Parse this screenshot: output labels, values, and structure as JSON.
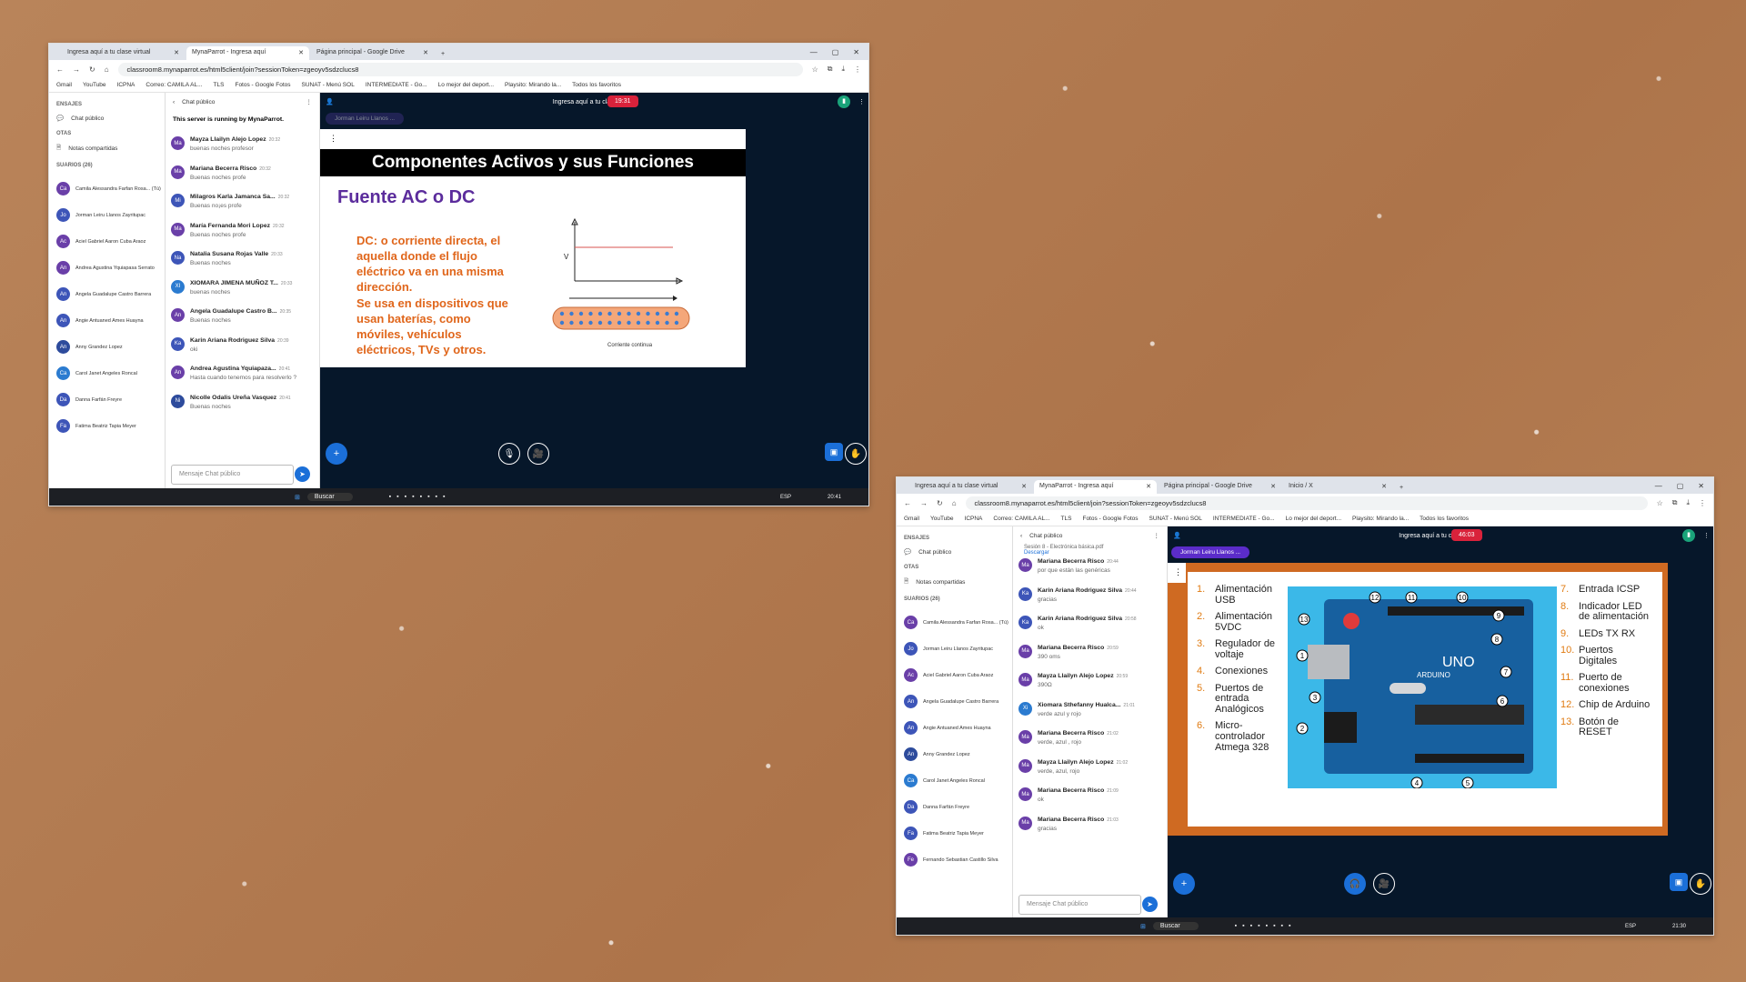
{
  "shot1": {
    "tabs": [
      {
        "label": "Ingresa aquí a tu clase virtual"
      },
      {
        "label": "MynaParrot - Ingresa aquí"
      },
      {
        "label": "Página principal - Google Drive"
      }
    ],
    "url": "classroom8.mynaparrot.es/html5client/join?sessionToken=zgeoyv5sdzclucs8",
    "bookmarks": [
      "Gmail",
      "YouTube",
      "ICPNA",
      "Correo: CAMILA AL...",
      "TLS",
      "Fotos - Google Fotos",
      "SUNAT - Menú SOL",
      "INTERMEDIATE - Go...",
      "Lo mejor del deport...",
      "Playsito: Mirando la...",
      "Todos los favoritos"
    ],
    "sidebar": {
      "mensajes": "ENSAJES",
      "public_chat": "Chat público",
      "notas": "OTAS",
      "shared_notes": "Notas compartidas",
      "usuarios": "SUARIOS (26)",
      "users": [
        {
          "ini": "Ca",
          "name": "Camila Alessandra Farfan Rosa... (Tú)",
          "color": "#6a3fa8"
        },
        {
          "ini": "Jo",
          "name": "Jorman Leiru Llanos Zayritupac",
          "color": "#3d55b8"
        },
        {
          "ini": "Ac",
          "name": "Aciel Gabriel Aaron Cuba Araoz",
          "color": "#6a3fa8"
        },
        {
          "ini": "An",
          "name": "Andrea Agustina Yquiapasa Serrato",
          "color": "#6a3fa8"
        },
        {
          "ini": "An",
          "name": "Angela Guadalupe Castro Barrera",
          "color": "#3d55b8"
        },
        {
          "ini": "An",
          "name": "Angie Antuaned Ames Huayna",
          "color": "#3d55b8"
        },
        {
          "ini": "An",
          "name": "Anny Grandez Lopez",
          "color": "#2d4b9c"
        },
        {
          "ini": "Ca",
          "name": "Carol Janet Angeles Roncal",
          "color": "#2b7bd0"
        },
        {
          "ini": "Da",
          "name": "Danna Farfán Freyre",
          "color": "#3d55b8"
        },
        {
          "ini": "Fa",
          "name": "Fatima Beatriz Tapia Meyer",
          "color": "#3d55b8"
        }
      ]
    },
    "chat": {
      "title": "Chat público",
      "server": "This server is running by MynaParrot.",
      "placeholder": "Mensaje Chat público",
      "messages": [
        {
          "ini": "Ma",
          "name": "Mayza Llailyn Alejo Lopez",
          "time": "20:32",
          "text": "buenas noches profesor",
          "color": "#6a3fa8"
        },
        {
          "ini": "Ma",
          "name": "Mariana Becerra Risco",
          "time": "20:32",
          "text": "Buenas noches profe",
          "color": "#6a3fa8"
        },
        {
          "ini": "Mi",
          "name": "Milagros Karla Jamanca Sa...",
          "time": "20:32",
          "text": "Buenas no¡es profe",
          "color": "#3d55b8"
        },
        {
          "ini": "Ma",
          "name": "María Fernanda Mori Lopez",
          "time": "20:32",
          "text": "Buenas noches profe",
          "color": "#6a3fa8"
        },
        {
          "ini": "Na",
          "name": "Natalia Susana Rojas Valle",
          "time": "20:33",
          "text": "Buenas noches",
          "color": "#3d55b8"
        },
        {
          "ini": "XI",
          "name": "XIOMARA JIMENA MUÑOZ T...",
          "time": "20:33",
          "text": "buenas noches",
          "color": "#2b7bd0"
        },
        {
          "ini": "An",
          "name": "Angela Guadalupe Castro B...",
          "time": "20:35",
          "text": "Buenas noches",
          "color": "#6a3fa8"
        },
        {
          "ini": "Ka",
          "name": "Karin Ariana Rodriguez Silva",
          "time": "20:39",
          "text": "oki",
          "color": "#3d55b8"
        },
        {
          "ini": "An",
          "name": "Andrea Agustina Yquiapaza...",
          "time": "20:41",
          "text": "Hasta cuando tenemos para resolverlo ?",
          "color": "#6a3fa8"
        },
        {
          "ini": "Ni",
          "name": "Nicolle Odalis Ureña Vasquez",
          "time": "20:41",
          "text": "Buenas noches",
          "color": "#2d4b9c"
        }
      ]
    },
    "room_title": "Ingresa aquí a tu clase virtual",
    "timer": "19:31",
    "presenter": "Jorman Leiru Llanos ...",
    "slide": {
      "title": "Componentes Activos y sus Funciones",
      "subtitle": "Fuente AC o DC",
      "body": "DC: o corriente directa, el aquella donde el flujo eléctrico va en una misma dirección.\nSe usa en dispositivos que usan baterías, como móviles, vehículos eléctricos, TVs y otros.",
      "axis_label": "V",
      "caption": "Corriente continua"
    },
    "taskbar": {
      "search": "Buscar",
      "lang": "ESP",
      "time": "20:41"
    }
  },
  "shot2": {
    "tabs": [
      {
        "label": "Ingresa aquí a tu clase virtual"
      },
      {
        "label": "MynaParrot - Ingresa aquí"
      },
      {
        "label": "Página principal - Google Drive"
      },
      {
        "label": "Inicio / X"
      }
    ],
    "url": "classroom8.mynaparrot.es/html5client/join?sessionToken=zgeoyv5sdzclucs8",
    "bookmarks": [
      "Gmail",
      "YouTube",
      "ICPNA",
      "Correo: CAMILA AL...",
      "TLS",
      "Fotos - Google Fotos",
      "SUNAT - Menú SOL",
      "INTERMEDIATE - Go...",
      "Lo mejor del deport...",
      "Playsito: Mirando la...",
      "Todos los favoritos"
    ],
    "sidebar": {
      "mensajes": "ENSAJES",
      "public_chat": "Chat público",
      "notas": "OTAS",
      "shared_notes": "Notas compartidas",
      "usuarios": "SUARIOS (26)",
      "users": [
        {
          "ini": "Ca",
          "name": "Camila Alessandra Farfan Rosa... (Tú)",
          "color": "#6a3fa8"
        },
        {
          "ini": "Jo",
          "name": "Jorman Leiru Llanos Zayritupac",
          "color": "#3d55b8"
        },
        {
          "ini": "Ac",
          "name": "Aciel Gabriel Aaron Cuba Araoz",
          "color": "#6a3fa8"
        },
        {
          "ini": "An",
          "name": "Angela Guadalupe Castro Barrera",
          "color": "#3d55b8"
        },
        {
          "ini": "An",
          "name": "Angie Antuaned Ames Huayna",
          "color": "#3d55b8"
        },
        {
          "ini": "An",
          "name": "Anny Grandez Lopez",
          "color": "#2d4b9c"
        },
        {
          "ini": "Ca",
          "name": "Carol Janet Angeles Roncal",
          "color": "#2b7bd0"
        },
        {
          "ini": "Da",
          "name": "Danna Farfán Freyre",
          "color": "#3d55b8"
        },
        {
          "ini": "Fa",
          "name": "Fatima Beatriz Tapia Meyer",
          "color": "#3d55b8"
        },
        {
          "ini": "Fe",
          "name": "Fernando Sebastian Castillo Silva",
          "color": "#6a3fa8"
        }
      ]
    },
    "chat": {
      "title": "Chat público",
      "top_text": "Sesión 8 - Electrónica básica.pdf",
      "download": "Descargar",
      "placeholder": "Mensaje Chat público",
      "messages": [
        {
          "ini": "Ma",
          "name": "Mariana Becerra Risco",
          "time": "20:44",
          "text": "por que están las genéricas",
          "color": "#6a3fa8"
        },
        {
          "ini": "Ka",
          "name": "Karin Ariana Rodriguez Silva",
          "time": "20:44",
          "text": "gracias",
          "color": "#3d55b8"
        },
        {
          "ini": "Ka",
          "name": "Karin Ariana Rodriguez Silva",
          "time": "20:58",
          "text": "ok",
          "color": "#3d55b8"
        },
        {
          "ini": "Ma",
          "name": "Mariana Becerra Risco",
          "time": "20:59",
          "text": "390 oms",
          "color": "#6a3fa8"
        },
        {
          "ini": "Ma",
          "name": "Mayza Llailyn Alejo Lopez",
          "time": "20:59",
          "text": "390Ω",
          "color": "#6a3fa8"
        },
        {
          "ini": "Xi",
          "name": "Xiomara Sthefanny Hualca...",
          "time": "21:01",
          "text": "verde azul y rojo",
          "color": "#2b7bd0"
        },
        {
          "ini": "Ma",
          "name": "Mariana Becerra Risco",
          "time": "21:02",
          "text": "verde, azul , rojo",
          "color": "#6a3fa8"
        },
        {
          "ini": "Ma",
          "name": "Mayza Llailyn Alejo Lopez",
          "time": "21:02",
          "text": "verde, azul, rojo",
          "color": "#6a3fa8"
        },
        {
          "ini": "Ma",
          "name": "Mariana Becerra Risco",
          "time": "21:09",
          "text": "ok",
          "color": "#6a3fa8"
        },
        {
          "ini": "Ma",
          "name": "Mariana Becerra Risco",
          "time": "21:03",
          "text": "gracias",
          "color": "#6a3fa8"
        }
      ]
    },
    "room_title": "Ingresa aquí a tu clase virtual",
    "timer": "46:03",
    "presenter": "Jorman Leiru Llanos ...",
    "slide": {
      "board_label": "UNO",
      "board_brand": "ARDUINO",
      "left_items": [
        {
          "n": "1.",
          "t": "Alimentación USB"
        },
        {
          "n": "2.",
          "t": "Alimentación 5VDC"
        },
        {
          "n": "3.",
          "t": "Regulador de voltaje"
        },
        {
          "n": "4.",
          "t": "Conexiones"
        },
        {
          "n": "5.",
          "t": "Puertos de entrada Analógicos"
        },
        {
          "n": "6.",
          "t": "Micro-controlador Atmega 328"
        }
      ],
      "right_items": [
        {
          "n": "7.",
          "t": "Entrada ICSP"
        },
        {
          "n": "8.",
          "t": "Indicador LED de alimentación"
        },
        {
          "n": "9.",
          "t": "LEDs TX RX"
        },
        {
          "n": "10.",
          "t": "Puertos Digitales"
        },
        {
          "n": "11.",
          "t": "Puerto de conexiones"
        },
        {
          "n": "12.",
          "t": "Chip de Arduino"
        },
        {
          "n": "13.",
          "t": "Botón de RESET"
        }
      ]
    },
    "taskbar": {
      "search": "Buscar",
      "lang": "ESP",
      "time": "21:30"
    }
  }
}
